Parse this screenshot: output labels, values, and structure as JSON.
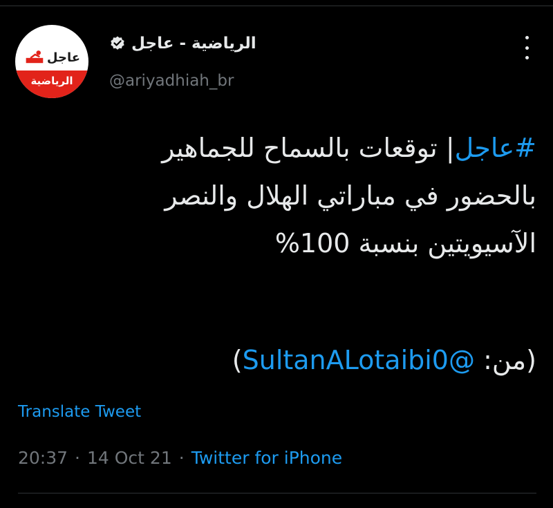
{
  "account": {
    "display_name": "الرياضية - عاجل",
    "handle": "@ariyadhiah_br",
    "avatar_badge_text": "عاجل",
    "avatar_brand_text": "الرياضية"
  },
  "icons": {
    "verified": "verified-badge-icon",
    "more": "more-vertical-icon"
  },
  "tweet": {
    "hashtag": "#عاجل",
    "line1_rest": "| توقعات بالسماح للجماهير",
    "line2": "بالحضور في مباراتي الهلال والنصر",
    "line3": "الآسيويتين بنسبة 100%",
    "credit_prefix": "(من: ",
    "mention": "@SultanALotaibi0",
    "credit_suffix": ")"
  },
  "translate_label": "Translate Tweet",
  "meta": {
    "time": "20:37",
    "separator": "·",
    "date": "14 Oct 21",
    "source": "Twitter for iPhone"
  },
  "colors": {
    "background": "#000000",
    "link_blue": "#1d9bf0",
    "secondary_gray": "#71767b",
    "brand_red": "#e2231a"
  }
}
